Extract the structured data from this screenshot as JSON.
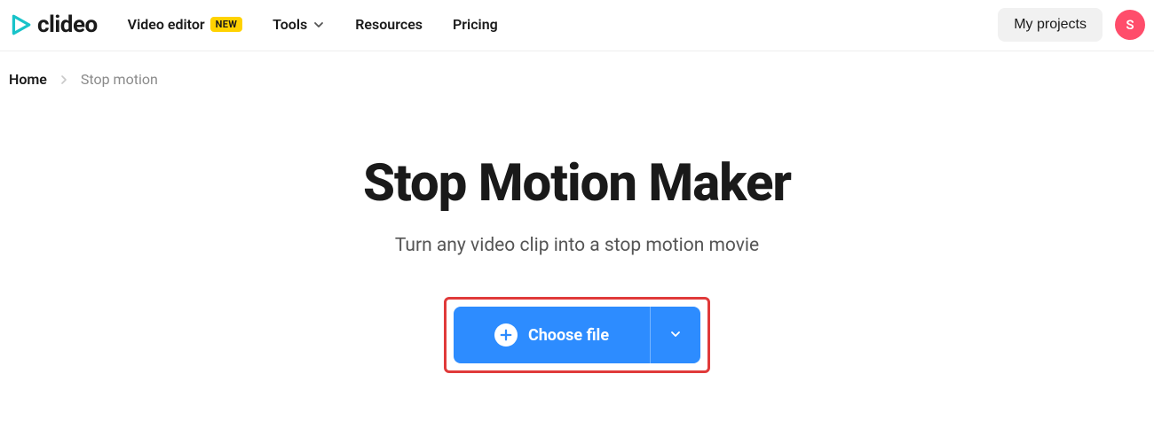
{
  "header": {
    "logo_text": "clideo",
    "nav": {
      "video_editor": "Video editor",
      "badge_new": "NEW",
      "tools": "Tools",
      "resources": "Resources",
      "pricing": "Pricing"
    },
    "my_projects": "My projects",
    "avatar_initial": "S"
  },
  "breadcrumb": {
    "home": "Home",
    "current": "Stop motion"
  },
  "hero": {
    "title": "Stop Motion Maker",
    "subtitle": "Turn any video clip into a stop motion movie"
  },
  "cta": {
    "label": "Choose file"
  }
}
